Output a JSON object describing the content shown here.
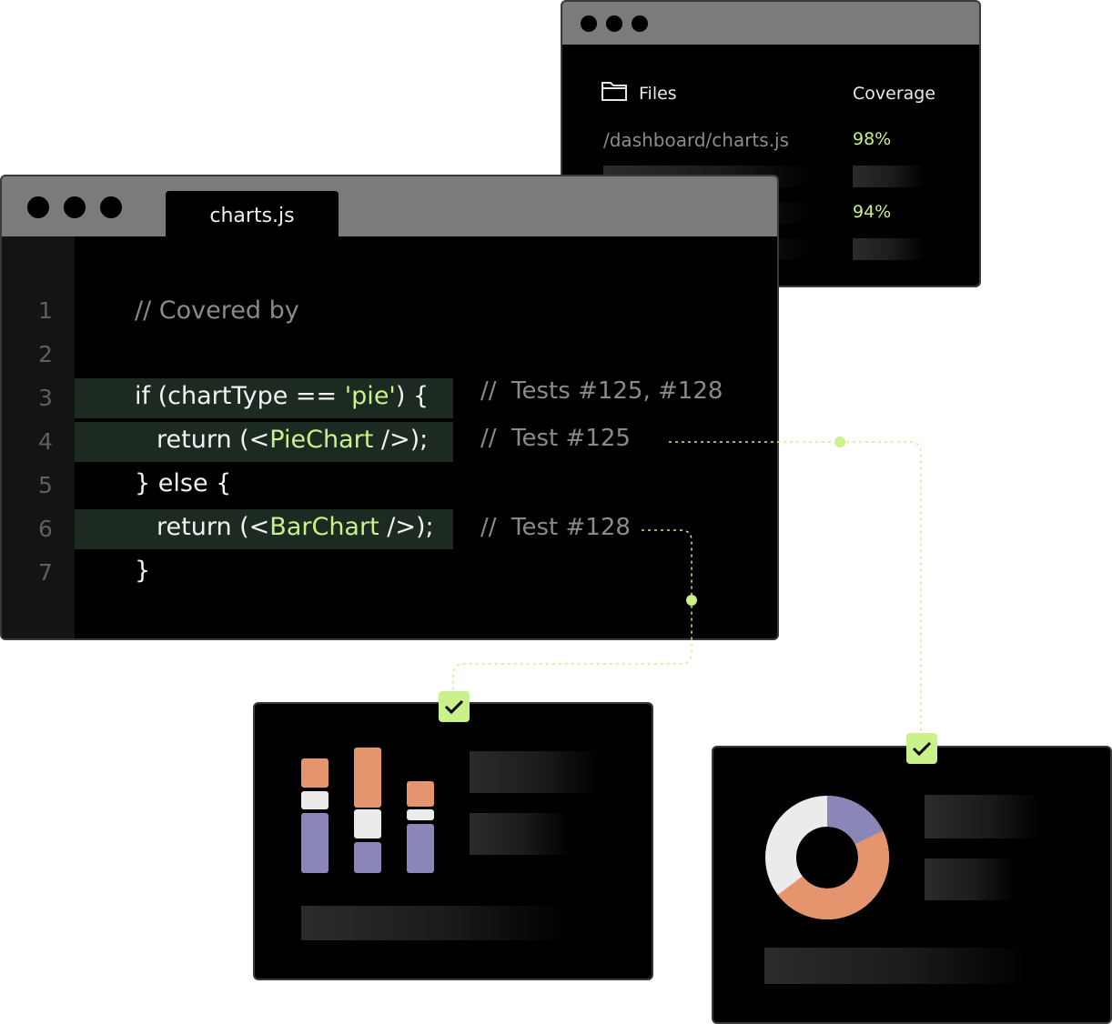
{
  "coverage_window": {
    "files_header": "Files",
    "coverage_header": "Coverage",
    "rows": [
      {
        "path": "/dashboard/charts.js",
        "coverage": "98%"
      },
      {
        "path": "",
        "coverage": "94%"
      }
    ],
    "icons": {
      "folder": "folder-icon"
    }
  },
  "editor": {
    "tab_label": "charts.js",
    "lines": [
      {
        "number": "1",
        "code": "// Covered by",
        "comment": ""
      },
      {
        "number": "2",
        "code": "",
        "comment": ""
      },
      {
        "number": "3",
        "code_pre": "if (chartType == ",
        "code_str": "'pie'",
        "code_post": ") {",
        "comment": "//  Tests #125, #128"
      },
      {
        "number": "4",
        "code_pre": "return (<",
        "code_str": "PieChart",
        "code_post": " />);",
        "comment": "//  Test #125"
      },
      {
        "number": "5",
        "code": "} else {",
        "comment": ""
      },
      {
        "number": "6",
        "code_pre": "return (<",
        "code_str": "BarChart",
        "code_post": " />);",
        "comment": "//  Test #128"
      },
      {
        "number": "7",
        "code": "}",
        "comment": ""
      }
    ]
  },
  "colors": {
    "accent_green": "#c9f28a",
    "orange": "#e5956d",
    "purple": "#8b86b8",
    "off_white": "#eceaea",
    "highlight_row": "#1c2a22"
  },
  "icons": {
    "check": "check-icon",
    "window_dots": "window-control-dot"
  }
}
